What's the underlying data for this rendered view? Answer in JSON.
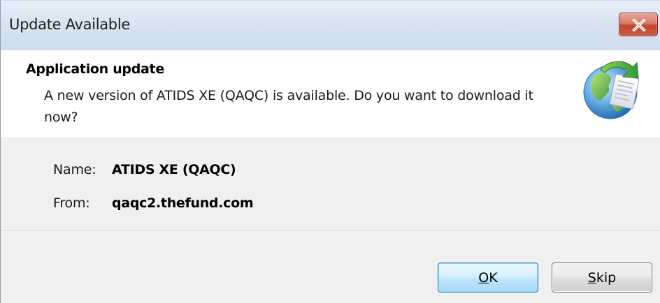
{
  "window": {
    "title": "Update Available",
    "close_icon": "close-x"
  },
  "header": {
    "title": "Application update",
    "description": "A new version of ATIDS XE (QAQC) is available. Do you want to download it now?",
    "icon": "globe-update-icon"
  },
  "details": {
    "name_label": "Name:",
    "name_value": "ATIDS XE (QAQC)",
    "from_label": "From:",
    "from_value": "qaqc2.thefund.com"
  },
  "buttons": {
    "ok": {
      "accel": "O",
      "rest": "K"
    },
    "skip": {
      "accel": "S",
      "rest": "kip"
    }
  },
  "colors": {
    "titlebar": "#d9e4f1",
    "close_button": "#c4442a",
    "ok_button_border": "#3c7fb1",
    "background": "#f0f0f0"
  }
}
